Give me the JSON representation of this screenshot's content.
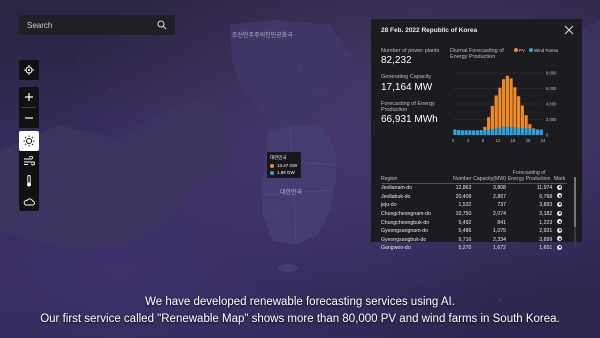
{
  "search": {
    "placeholder": "Search"
  },
  "map": {
    "labels": {
      "north_korea": "조선민주주의인민공화국",
      "south_korea": "대한민국"
    }
  },
  "tooltip": {
    "title": "대한민국",
    "pv": "13.47 GW",
    "wind": "1.99 GW"
  },
  "panel": {
    "title": "28 Feb. 2022 Republic of Korea",
    "stats": [
      {
        "label": "Number of power plants",
        "value": "82,232"
      },
      {
        "label": "Generating Capacity",
        "value": "17,164 MW"
      },
      {
        "label": "Forecasting of Energy Production",
        "value": "66,931 MWh"
      }
    ],
    "chart_title": "Diurnal Forecasting of Energy Production",
    "legend": {
      "pv": "PV",
      "wind": "Wind Farms"
    },
    "colors": {
      "pv": "#f08a24",
      "wind": "#2aa6e8"
    }
  },
  "chart_data": {
    "type": "bar",
    "title": "Diurnal Forecasting of Energy Production",
    "x_ticks": [
      "0",
      "4",
      "8",
      "12",
      "16",
      "20",
      "24"
    ],
    "y_ticks": [
      "8,000",
      "6,000",
      "4,000",
      "2,000",
      "0"
    ],
    "ylim": [
      0,
      8000
    ],
    "stacked": true,
    "series": [
      {
        "name": "PV",
        "values": [
          0,
          0,
          0,
          0,
          0,
          0,
          0,
          50,
          400,
          1600,
          3000,
          4300,
          5200,
          6200,
          6600,
          6300,
          5200,
          4100,
          2900,
          1700,
          600,
          100,
          0,
          0
        ]
      },
      {
        "name": "Wind Farms",
        "values": [
          700,
          650,
          600,
          600,
          600,
          600,
          600,
          600,
          650,
          700,
          750,
          800,
          900,
          1000,
          1050,
          1000,
          950,
          900,
          900,
          850,
          800,
          750,
          700,
          700
        ]
      }
    ]
  },
  "table": {
    "headers": [
      "Region",
      "Number",
      "Capacity(MW)",
      "Forecasting of Energy Production",
      "Mark"
    ],
    "rows": [
      [
        "Jeollanam-do",
        "12,863",
        "3,808",
        "11,974"
      ],
      [
        "Jeollabuk-do",
        "20,409",
        "2,867",
        "6,768"
      ],
      [
        "jeju-do",
        "1,532",
        "737",
        "3,893"
      ],
      [
        "Chungcheongnam-do",
        "10,750",
        "2,074",
        "3,182"
      ],
      [
        "Chungcheongbuk-do",
        "5,492",
        "841",
        "1,223"
      ],
      [
        "Gyeongsangnam-do",
        "5,486",
        "1,075",
        "2,931"
      ],
      [
        "Gyeongsangbuk-do",
        "9,716",
        "2,334",
        "3,899"
      ],
      [
        "Gangwon-do",
        "5,270",
        "1,672",
        "1,651"
      ]
    ]
  },
  "captions": [
    "We have developed renewable forecasting services using AI.",
    "Our first service called \"Renewable Map\" shows more than 80,000 PV and wind farms in South Korea."
  ]
}
